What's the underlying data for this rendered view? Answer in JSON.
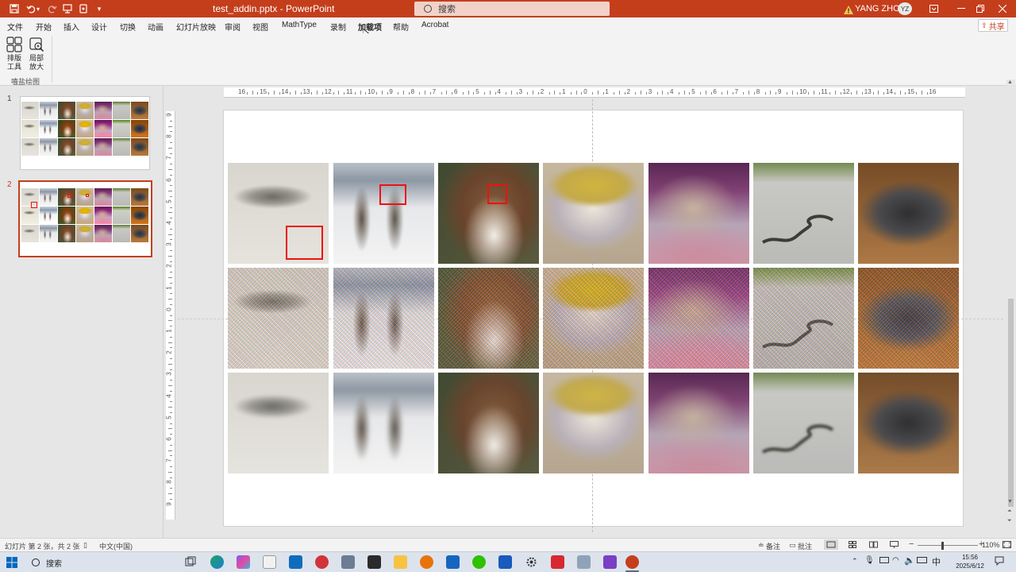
{
  "titlebar": {
    "title": "test_addin.pptx  -  PowerPoint",
    "search_placeholder": "搜索",
    "user_name": "YANG ZHOU",
    "user_initials": "YZ"
  },
  "ribbon_tabs": [
    {
      "label": "文件",
      "active": false
    },
    {
      "label": "开始",
      "active": false
    },
    {
      "label": "插入",
      "active": false
    },
    {
      "label": "设计",
      "active": false
    },
    {
      "label": "切换",
      "active": false
    },
    {
      "label": "动画",
      "active": false
    },
    {
      "label": "幻灯片放映",
      "active": false
    },
    {
      "label": "审阅",
      "active": false
    },
    {
      "label": "视图",
      "active": false
    },
    {
      "label": "MathType",
      "active": false
    },
    {
      "label": "录制",
      "active": false
    },
    {
      "label": "加载项",
      "active": true
    },
    {
      "label": "帮助",
      "active": false
    },
    {
      "label": "Acrobat",
      "active": false
    }
  ],
  "share_label": "共享",
  "ribbon": {
    "buttons": [
      {
        "label_line1": "排版",
        "label_line2": "工具",
        "icon": "layout-grid-icon"
      },
      {
        "label_line1": "局部",
        "label_line2": "放大",
        "icon": "zoom-in-icon"
      }
    ],
    "group_label": "嗑盐绘图"
  },
  "thumbnails": [
    {
      "number": "1",
      "active": false
    },
    {
      "number": "2",
      "active": true
    }
  ],
  "ruler": {
    "h_labels": [
      "16",
      "15",
      "14",
      "13",
      "12",
      "11",
      "10",
      "9",
      "8",
      "7",
      "6",
      "5",
      "4",
      "3",
      "2",
      "1",
      "0",
      "1",
      "2",
      "3",
      "4",
      "5",
      "6",
      "7",
      "8",
      "9",
      "10",
      "11",
      "12",
      "13",
      "14",
      "15",
      "16"
    ],
    "v_labels": [
      "9",
      "8",
      "7",
      "6",
      "5",
      "4",
      "3",
      "2",
      "1",
      "0",
      "1",
      "2",
      "3",
      "4",
      "5",
      "6",
      "7",
      "8",
      "9"
    ]
  },
  "slide_images": {
    "columns": [
      "snake-on-sand",
      "skiers-in-snow",
      "collie-dog",
      "yellow-soup-bowl",
      "pink-cloth-flowers",
      "snake-on-road",
      "furry-bundle"
    ],
    "rows": [
      "blurred",
      "noisy",
      "motion-blurred"
    ]
  },
  "statusbar": {
    "slide_info": "幻灯片 第 2 张，共 2 张",
    "language": "中文(中国)",
    "notes": "备注",
    "comments": "批注",
    "zoom": "110%"
  },
  "taskbar": {
    "search": "搜索",
    "ime": "中",
    "time": "15:56",
    "date": "2025/6/12"
  },
  "colors": {
    "accent": "#c43e1c",
    "red_box": "#ee1111"
  }
}
